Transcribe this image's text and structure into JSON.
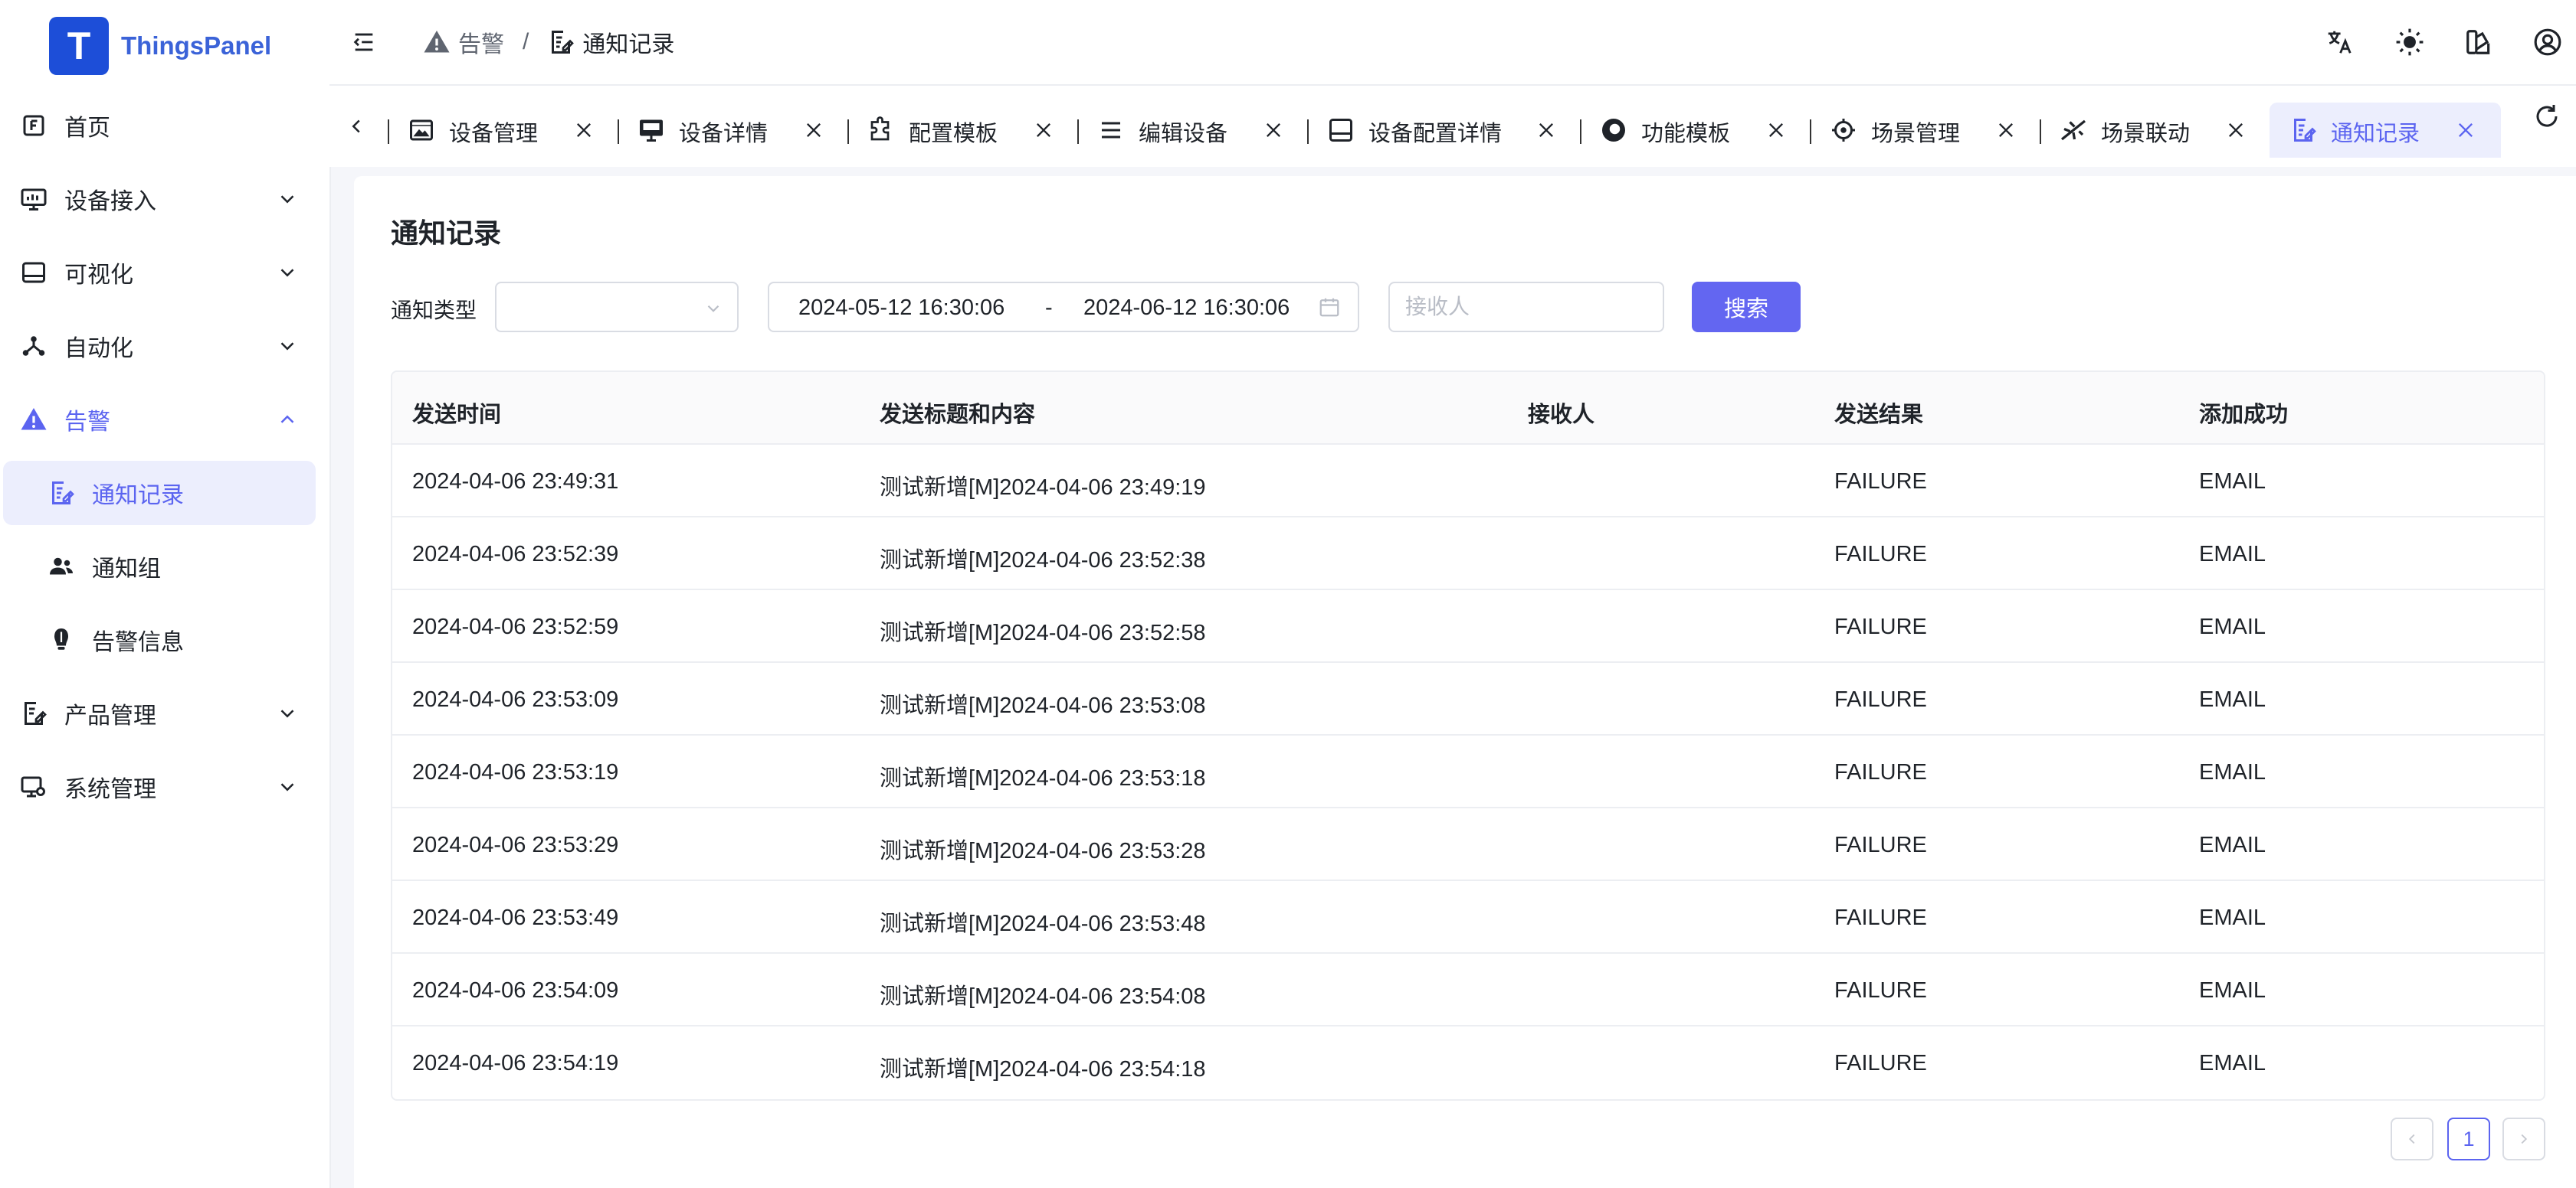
{
  "app": {
    "name": "ThingsPanel",
    "logo_letter": "T"
  },
  "sidebar": {
    "items": [
      {
        "label": "首页",
        "icon": "home-icon"
      },
      {
        "label": "设备接入",
        "icon": "monitor-icon"
      },
      {
        "label": "可视化",
        "icon": "visual-screen-icon"
      },
      {
        "label": "自动化",
        "icon": "network-icon"
      },
      {
        "label": "告警",
        "icon": "warning-icon"
      },
      {
        "label": "通知记录",
        "icon": "note-edit-icon"
      },
      {
        "label": "通知组",
        "icon": "user-group-icon"
      },
      {
        "label": "告警信息",
        "icon": "alarm-bulb-icon"
      },
      {
        "label": "产品管理",
        "icon": "product-icon"
      },
      {
        "label": "系统管理",
        "icon": "system-settings-icon"
      }
    ]
  },
  "breadcrumb": {
    "parent": "告警",
    "separator": "/",
    "current": "通知记录"
  },
  "tabs": [
    {
      "label": "设备管理",
      "icon": "image-icon"
    },
    {
      "label": "设备详情",
      "icon": "device-screen-icon"
    },
    {
      "label": "配置模板",
      "icon": "puzzle-icon"
    },
    {
      "label": "编辑设备",
      "icon": "menu-icon"
    },
    {
      "label": "设备配置详情",
      "icon": "tablet-icon"
    },
    {
      "label": "功能模板",
      "icon": "function-icon"
    },
    {
      "label": "场景管理",
      "icon": "settings-icon"
    },
    {
      "label": "场景联动",
      "icon": "airplane-icon"
    },
    {
      "label": "通知记录",
      "icon": "note-edit-icon"
    }
  ],
  "page": {
    "title": "通知记录",
    "filter": {
      "type_label": "通知类型",
      "type_value": "",
      "date_start": "2024-05-12 16:30:06",
      "date_separator": "-",
      "date_end": "2024-06-12 16:30:06",
      "receiver_placeholder": "接收人",
      "receiver_value": "",
      "search_label": "搜索"
    },
    "table": {
      "columns": [
        "发送时间",
        "发送标题和内容",
        "接收人",
        "发送结果",
        "添加成功"
      ],
      "rows": [
        [
          "2024-04-06 23:49:31",
          "测试新增[M]2024-04-06 23:49:19",
          "",
          "FAILURE",
          "EMAIL"
        ],
        [
          "2024-04-06 23:52:39",
          "测试新增[M]2024-04-06 23:52:38",
          "",
          "FAILURE",
          "EMAIL"
        ],
        [
          "2024-04-06 23:52:59",
          "测试新增[M]2024-04-06 23:52:58",
          "",
          "FAILURE",
          "EMAIL"
        ],
        [
          "2024-04-06 23:53:09",
          "测试新增[M]2024-04-06 23:53:08",
          "",
          "FAILURE",
          "EMAIL"
        ],
        [
          "2024-04-06 23:53:19",
          "测试新增[M]2024-04-06 23:53:18",
          "",
          "FAILURE",
          "EMAIL"
        ],
        [
          "2024-04-06 23:53:29",
          "测试新增[M]2024-04-06 23:53:28",
          "",
          "FAILURE",
          "EMAIL"
        ],
        [
          "2024-04-06 23:53:49",
          "测试新增[M]2024-04-06 23:53:48",
          "",
          "FAILURE",
          "EMAIL"
        ],
        [
          "2024-04-06 23:54:09",
          "测试新增[M]2024-04-06 23:54:08",
          "",
          "FAILURE",
          "EMAIL"
        ],
        [
          "2024-04-06 23:54:19",
          "测试新增[M]2024-04-06 23:54:18",
          "",
          "FAILURE",
          "EMAIL"
        ]
      ]
    },
    "pagination": {
      "current_page": "1"
    }
  },
  "colors": {
    "accent": "#6366f1",
    "logo": "#1d4ed8",
    "active_bg": "#eceefd"
  }
}
